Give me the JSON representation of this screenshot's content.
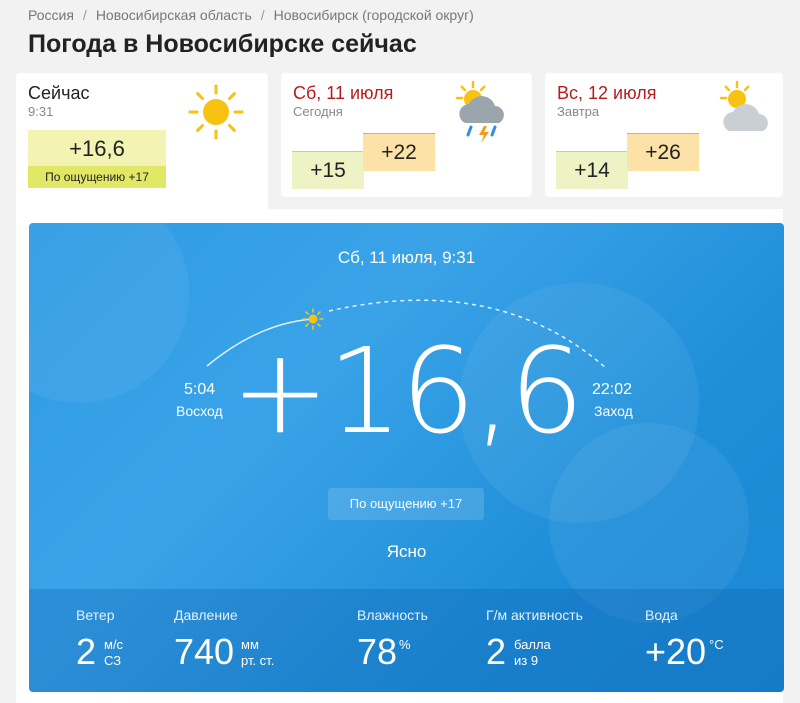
{
  "breadcrumb": [
    "Россия",
    "Новосибирская область",
    "Новосибирск (городской округ)"
  ],
  "page_title": "Погода в Новосибирске сейчас",
  "cards": {
    "now": {
      "title": "Сейчас",
      "time": "9:31",
      "temp": "+16,6",
      "feels": "По ощущению +17",
      "icon": "sun-icon"
    },
    "sat": {
      "title": "Сб, 11 июля",
      "subtitle": "Сегодня",
      "low": "+15",
      "high": "+22",
      "icon": "partly-cloudy-thunderstorm-icon"
    },
    "sun": {
      "title": "Вс, 12 июля",
      "subtitle": "Завтра",
      "low": "+14",
      "high": "+26",
      "icon": "partly-cloudy-icon"
    }
  },
  "main": {
    "datetime": "Сб, 11 июля, 9:31",
    "temp": "+16,6",
    "feels": "По ощущению +17",
    "condition": "Ясно",
    "sunrise": {
      "time": "5:04",
      "label": "Восход"
    },
    "sunset": {
      "time": "22:02",
      "label": "Заход"
    }
  },
  "stats": {
    "wind": {
      "label": "Ветер",
      "value": "2",
      "unit": "м/с",
      "dir": "СЗ"
    },
    "pressure": {
      "label": "Давление",
      "value": "740",
      "unit": "мм",
      "unit2": "рт. ст."
    },
    "humidity": {
      "label": "Влажность",
      "value": "78",
      "unit": "%"
    },
    "geomag": {
      "label": "Г/м активность",
      "value": "2",
      "unit": "балла",
      "unit2": "из 9"
    },
    "water": {
      "label": "Вода",
      "value": "+20",
      "unit": "°C"
    }
  },
  "colors": {
    "accent_red": "#b71c1c",
    "panel_blue": "#2d9be4",
    "sun": "#f7c212",
    "high_temp": "#fde2a8",
    "low_temp": "#eef3c6"
  }
}
